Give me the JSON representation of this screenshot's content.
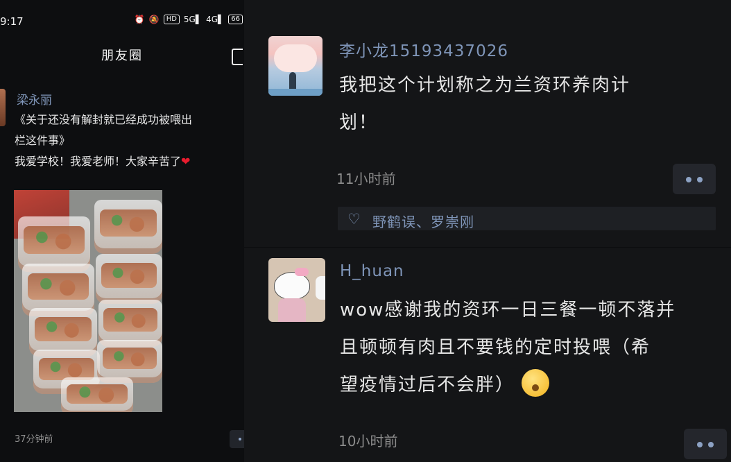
{
  "statusbar": {
    "time": "9:17",
    "icons": [
      "alarm-icon",
      "mute-icon",
      "hd-icon",
      "signal-5g-icon",
      "signal-4g-icon",
      "battery-icon"
    ],
    "hd_label": "HD",
    "net1": "5G",
    "net2": "4G",
    "battery": "66"
  },
  "nav": {
    "title": "朋友圈"
  },
  "left_post": {
    "author": "梁永丽",
    "text_line1": "《关于还没有解封就已经成功被喂出",
    "text_line2": "栏这件事》",
    "text_line3": "我爱学校！我爱老师！大家辛苦了",
    "heart": "❤",
    "time": "37分钟前"
  },
  "comments": [
    {
      "name": "李小龙15193437026",
      "text": "我把这个计划称之为兰资环养肉计\n划！",
      "time": "11小时前",
      "likes": "野鹤误、罗崇刚"
    },
    {
      "name": "H_huan",
      "text": "wow感谢我的资环一日三餐一顿不落并\n且顿顿有肉且不要钱的定时投喂（希\n望疫情过后不会胖）",
      "time": "10小时前"
    }
  ],
  "colors": {
    "link_blue": "#7f95b8",
    "background": "#141517",
    "text": "#e6e6e6"
  }
}
